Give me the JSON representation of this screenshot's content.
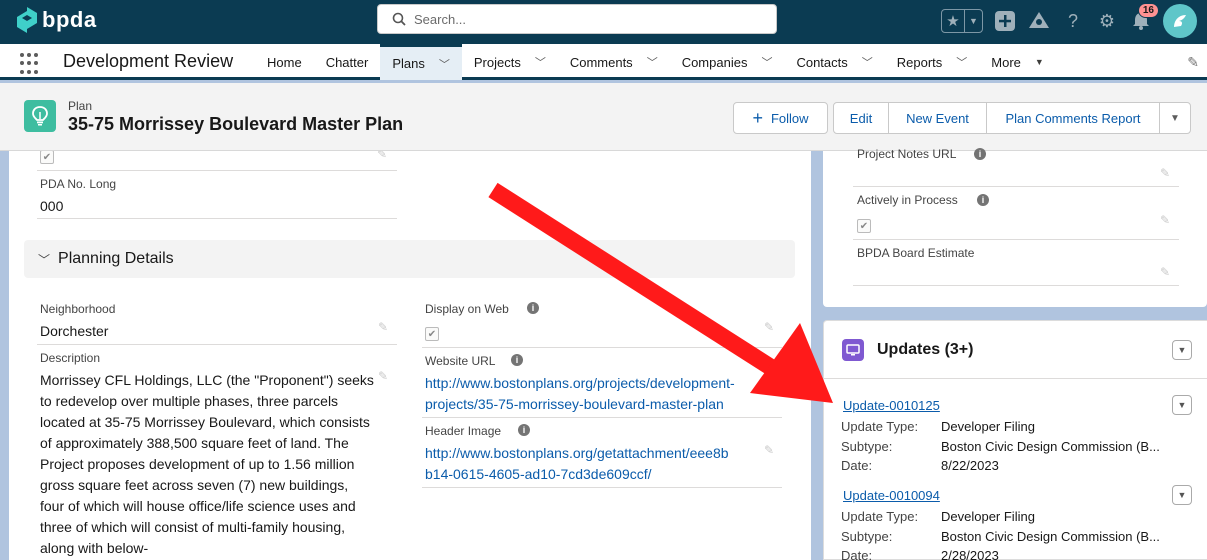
{
  "header": {
    "logo_text": "bpda",
    "search_placeholder": "Search...",
    "notification_count": "16",
    "icons": [
      "favorites-star-icon",
      "favorites-caret-icon",
      "add-icon",
      "trailhead-icon",
      "help-icon",
      "setup-gear-icon",
      "notifications-bell-icon",
      "user-avatar-icon"
    ]
  },
  "nav": {
    "app_name": "Development Review",
    "items": [
      {
        "label": "Home",
        "caret": false,
        "active": false
      },
      {
        "label": "Chatter",
        "caret": false,
        "active": false
      },
      {
        "label": "Plans",
        "caret": true,
        "active": true
      },
      {
        "label": "Projects",
        "caret": true,
        "active": false
      },
      {
        "label": "Comments",
        "caret": true,
        "active": false
      },
      {
        "label": "Companies",
        "caret": true,
        "active": false
      },
      {
        "label": "Contacts",
        "caret": true,
        "active": false
      },
      {
        "label": "Reports",
        "caret": true,
        "active": false
      },
      {
        "label": "More",
        "caret": true,
        "active": false
      }
    ]
  },
  "record": {
    "type": "Plan",
    "title": "35-75 Morrissey Boulevard Master Plan",
    "buttons": {
      "follow": "Follow",
      "edit": "Edit",
      "new_event": "New Event",
      "report": "Plan Comments Report"
    }
  },
  "details": {
    "pda_label": "PDA No. Long",
    "pda_value": "000",
    "section_title": "Planning Details",
    "neighborhood_label": "Neighborhood",
    "neighborhood_value": "Dorchester",
    "description_label": "Description",
    "description_value": "Morrissey CFL Holdings, LLC (the \"Proponent\") seeks to redevelop over multiple phases, three parcels located at 35-75 Morrissey Boulevard, which consists of approximately 388,500 square feet of land. The Project proposes development of up to 1.56 million gross square feet across seven (7) new buildings, four of which will house office/life science uses and three of which will consist of multi-family housing, along with below-",
    "display_on_web_label": "Display on Web",
    "display_on_web_checked": true,
    "website_label": "Website URL",
    "website_line1": "http://www.bostonplans.org/projects/development-",
    "website_line2": "projects/35-75-morrissey-boulevard-master-plan",
    "header_image_label": "Header Image",
    "header_image_line1": "http://www.bostonplans.org/getattachment/eee8b",
    "header_image_line2": "b14-0615-4605-ad10-7cd3de609ccf/"
  },
  "sidebar": {
    "project_notes_label": "Project Notes URL",
    "actively_label": "Actively in Process",
    "actively_checked": true,
    "board_label": "BPDA Board Estimate"
  },
  "updates": {
    "title": "Updates (3+)",
    "type_label": "Update Type:",
    "subtype_label": "Subtype:",
    "date_label": "Date:",
    "items": [
      {
        "name": "Update-0010125",
        "type": "Developer Filing",
        "subtype": "Boston Civic Design Commission (B...",
        "date": "8/22/2023"
      },
      {
        "name": "Update-0010094",
        "type": "Developer Filing",
        "subtype": "Boston Civic Design Commission (B...",
        "date": "2/28/2023"
      }
    ]
  },
  "annotation": {
    "arrow_color": "#ff1a1a"
  }
}
